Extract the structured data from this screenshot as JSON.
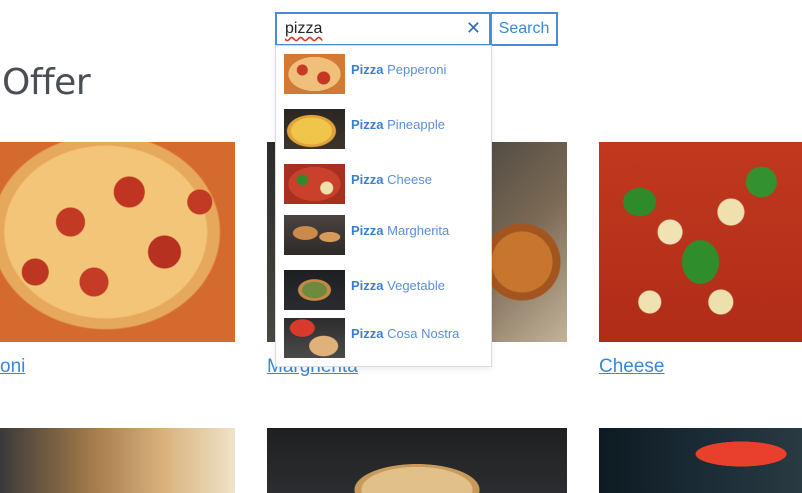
{
  "page": {
    "heading": "Offer"
  },
  "search": {
    "value": "pizza",
    "clear_icon": "close-icon",
    "button_label": "Search"
  },
  "suggestions": [
    {
      "bold": "Pizza",
      "rest": "Pepperoni"
    },
    {
      "bold": "Pizza",
      "rest": "Pineapple"
    },
    {
      "bold": "Pizza",
      "rest": "Cheese"
    },
    {
      "bold": "Pizza",
      "rest": "Margherita"
    },
    {
      "bold": "Pizza",
      "rest": "Vegetable"
    },
    {
      "bold": "Pizza",
      "rest": "Cosa Nostra"
    }
  ],
  "cards": [
    {
      "label": "oni"
    },
    {
      "label": "Margherita"
    },
    {
      "label": "Cheese"
    }
  ],
  "colors": {
    "accent": "#3a87d8",
    "search_border": "#4a8be0",
    "heading": "#4a4f55"
  }
}
